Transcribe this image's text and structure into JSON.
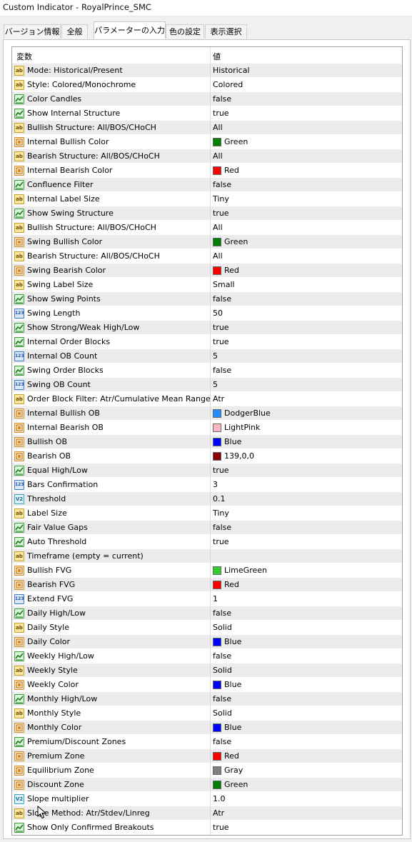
{
  "window": {
    "title": "Custom Indicator - RoyalPrince_SMC"
  },
  "tabs": [
    {
      "label": "バージョン情報"
    },
    {
      "label": "全般"
    },
    {
      "label": "パラメーターの入力",
      "active": true
    },
    {
      "label": "色の設定"
    },
    {
      "label": "表示選択"
    }
  ],
  "table": {
    "col_variable": "変数",
    "col_value": "値",
    "rows": [
      {
        "type": "string",
        "name": "Mode: Historical/Present",
        "value": "Historical"
      },
      {
        "type": "string",
        "name": "Style: Colored/Monochrome",
        "value": "Colored"
      },
      {
        "type": "bool",
        "name": "Color Candles",
        "value": "false"
      },
      {
        "type": "bool",
        "name": "Show Internal Structure",
        "value": "true"
      },
      {
        "type": "string",
        "name": "Bullish Structure: All/BOS/CHoCH",
        "value": "All"
      },
      {
        "type": "color",
        "name": "Internal Bullish Color",
        "value": "Green",
        "color": "#008000"
      },
      {
        "type": "string",
        "name": "Bearish Structure: All/BOS/CHoCH",
        "value": "All"
      },
      {
        "type": "color",
        "name": "Internal Bearish Color",
        "value": "Red",
        "color": "#ff0000"
      },
      {
        "type": "bool",
        "name": "Confluence Filter",
        "value": "false"
      },
      {
        "type": "string",
        "name": "Internal Label Size",
        "value": "Tiny"
      },
      {
        "type": "bool",
        "name": "Show Swing Structure",
        "value": "true"
      },
      {
        "type": "string",
        "name": "Bullish Structure: All/BOS/CHoCH",
        "value": "All"
      },
      {
        "type": "color",
        "name": "Swing Bullish Color",
        "value": "Green",
        "color": "#008000"
      },
      {
        "type": "string",
        "name": "Bearish Structure: All/BOS/CHoCH",
        "value": "All"
      },
      {
        "type": "color",
        "name": "Swing Bearish Color",
        "value": "Red",
        "color": "#ff0000"
      },
      {
        "type": "string",
        "name": "Swing Label Size",
        "value": "Small"
      },
      {
        "type": "bool",
        "name": "Show Swing Points",
        "value": "false"
      },
      {
        "type": "int",
        "name": "Swing Length",
        "value": "50"
      },
      {
        "type": "bool",
        "name": "Show Strong/Weak High/Low",
        "value": "true"
      },
      {
        "type": "bool",
        "name": "Internal Order Blocks",
        "value": "true"
      },
      {
        "type": "int",
        "name": "Internal OB Count",
        "value": "5"
      },
      {
        "type": "bool",
        "name": "Swing Order Blocks",
        "value": "false"
      },
      {
        "type": "int",
        "name": "Swing OB Count",
        "value": "5"
      },
      {
        "type": "string",
        "name": "Order Block Filter: Atr/Cumulative Mean Range",
        "value": "Atr"
      },
      {
        "type": "color",
        "name": "Internal Bullish OB",
        "value": "DodgerBlue",
        "color": "#1e90ff"
      },
      {
        "type": "color",
        "name": "Internal Bearish OB",
        "value": "LightPink",
        "color": "#ffb6c1"
      },
      {
        "type": "color",
        "name": "Bullish OB",
        "value": "Blue",
        "color": "#0000ff"
      },
      {
        "type": "color",
        "name": "Bearish OB",
        "value": "139,0,0",
        "color": "#8b0000"
      },
      {
        "type": "bool",
        "name": "Equal High/Low",
        "value": "true"
      },
      {
        "type": "int",
        "name": "Bars Confirmation",
        "value": "3"
      },
      {
        "type": "double",
        "name": "Threshold",
        "value": "0.1"
      },
      {
        "type": "string",
        "name": "Label Size",
        "value": "Tiny"
      },
      {
        "type": "bool",
        "name": "Fair Value Gaps",
        "value": "false"
      },
      {
        "type": "bool",
        "name": "Auto Threshold",
        "value": "true"
      },
      {
        "type": "string",
        "name": "Timeframe (empty = current)",
        "value": ""
      },
      {
        "type": "color",
        "name": "Bullish FVG",
        "value": "LimeGreen",
        "color": "#32cd32"
      },
      {
        "type": "color",
        "name": "Bearish FVG",
        "value": "Red",
        "color": "#ff0000"
      },
      {
        "type": "int",
        "name": "Extend FVG",
        "value": "1"
      },
      {
        "type": "bool",
        "name": "Daily High/Low",
        "value": "false"
      },
      {
        "type": "string",
        "name": "Daily Style",
        "value": "Solid"
      },
      {
        "type": "color",
        "name": "Daily Color",
        "value": "Blue",
        "color": "#0000ff"
      },
      {
        "type": "bool",
        "name": "Weekly High/Low",
        "value": "false"
      },
      {
        "type": "string",
        "name": "Weekly Style",
        "value": "Solid"
      },
      {
        "type": "color",
        "name": "Weekly Color",
        "value": "Blue",
        "color": "#0000ff"
      },
      {
        "type": "bool",
        "name": "Monthly High/Low",
        "value": "false"
      },
      {
        "type": "string",
        "name": "Monthly Style",
        "value": "Solid"
      },
      {
        "type": "color",
        "name": "Monthly Color",
        "value": "Blue",
        "color": "#0000ff"
      },
      {
        "type": "bool",
        "name": "Premium/Discount Zones",
        "value": "false"
      },
      {
        "type": "color",
        "name": "Premium Zone",
        "value": "Red",
        "color": "#ff0000"
      },
      {
        "type": "color",
        "name": "Equilibrium Zone",
        "value": "Gray",
        "color": "#808080"
      },
      {
        "type": "color",
        "name": "Discount Zone",
        "value": "Green",
        "color": "#008000"
      },
      {
        "type": "double",
        "name": "Slope multiplier",
        "value": "1.0"
      },
      {
        "type": "string",
        "name": "Slope Method: Atr/Stdev/Linreg",
        "value": "Atr"
      },
      {
        "type": "bool",
        "name": "Show Only Confirmed Breakouts",
        "value": "true"
      }
    ]
  },
  "icons": {
    "string": "ab",
    "int": "123",
    "double": "V2"
  }
}
